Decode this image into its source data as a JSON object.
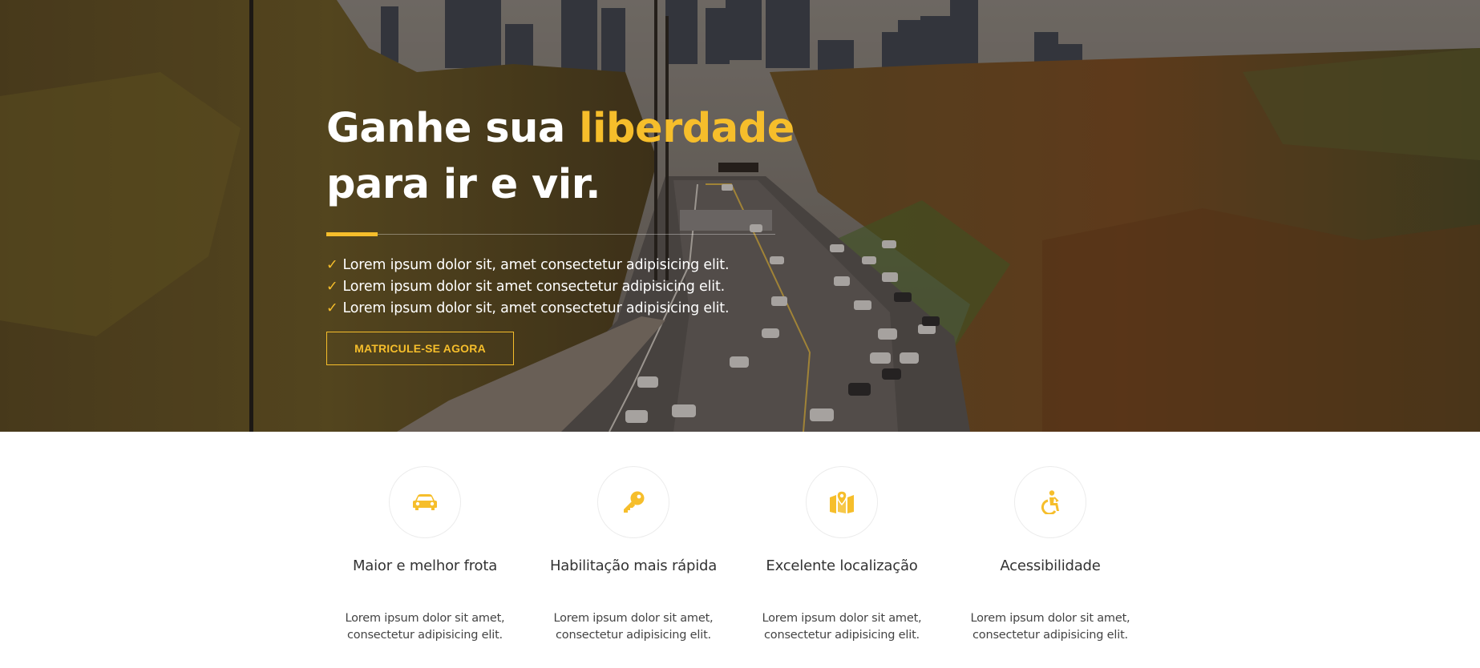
{
  "hero": {
    "title_part1": "Ganhe sua ",
    "title_accent": "liberdade",
    "title_part2": "para ir e vir.",
    "checks": [
      "Lorem ipsum dolor sit, amet consectetur adipisicing elit.",
      "Lorem ipsum dolor sit amet consectetur adipisicing elit.",
      "Lorem ipsum dolor sit, amet consectetur adipisicing elit."
    ],
    "check_mark": "✓",
    "cta_label": "MATRICULE-SE AGORA"
  },
  "features": [
    {
      "icon": "car-icon",
      "title": "Maior e melhor frota",
      "desc_line1": "Lorem ipsum dolor sit amet,",
      "desc_line2": "consectetur adipisicing elit."
    },
    {
      "icon": "key-icon",
      "title": "Habilitação mais rápida",
      "desc_line1": "Lorem ipsum dolor sit amet,",
      "desc_line2": "consectetur adipisicing elit."
    },
    {
      "icon": "map-marker-icon",
      "title": "Excelente localização",
      "desc_line1": "Lorem ipsum dolor sit amet,",
      "desc_line2": "consectetur adipisicing elit."
    },
    {
      "icon": "accessibility-icon",
      "title": "Acessibilidade",
      "desc_line1": "Lorem ipsum dolor sit amet,",
      "desc_line2": "consectetur adipisicing elit."
    }
  ],
  "colors": {
    "accent": "#f6be2b",
    "text": "#333333",
    "hero_text": "#ffffff"
  }
}
